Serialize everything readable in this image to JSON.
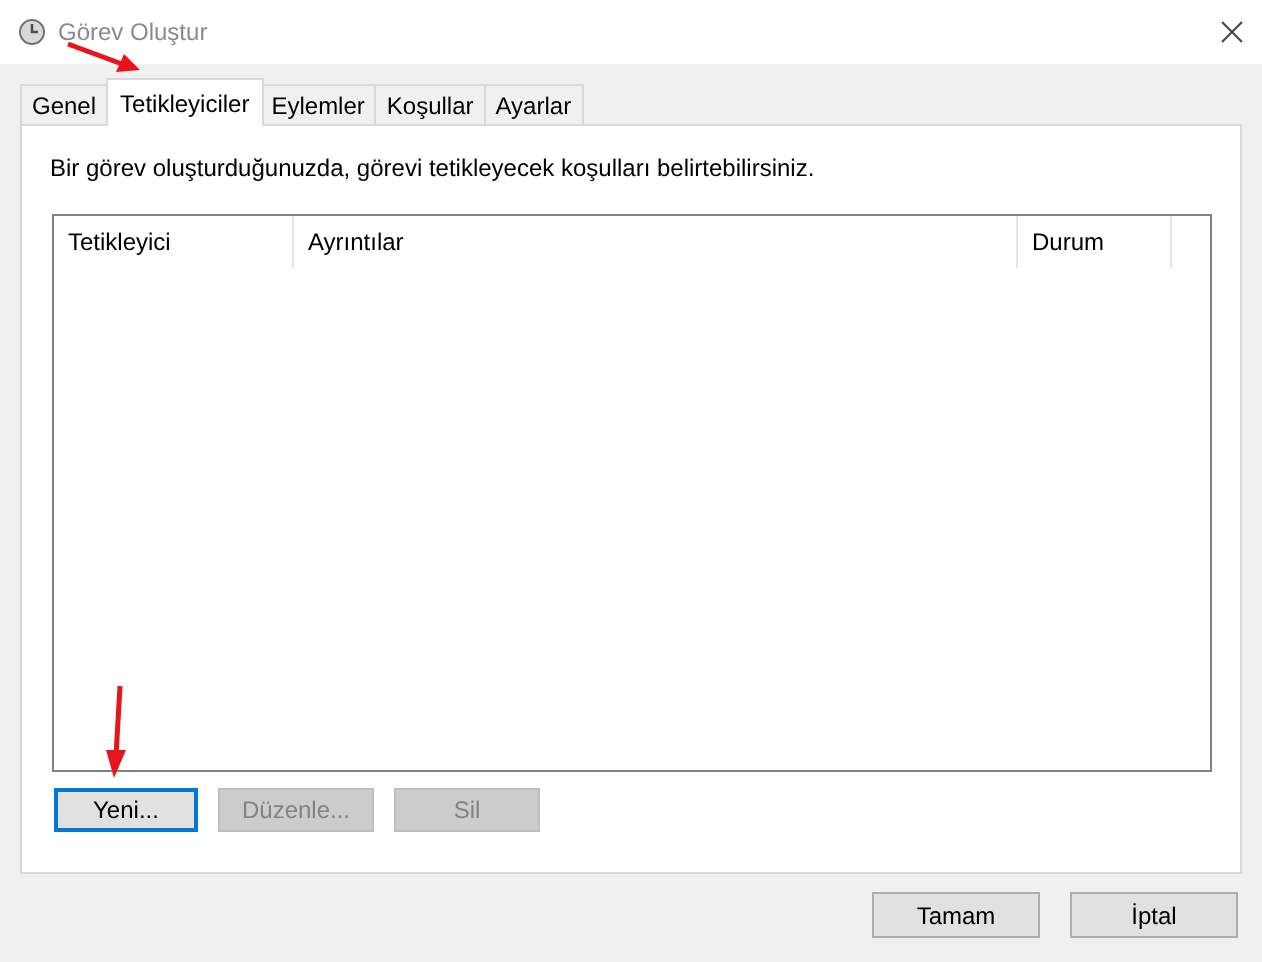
{
  "window": {
    "title": "Görev Oluştur"
  },
  "tabs": [
    {
      "label": "Genel",
      "selected": false
    },
    {
      "label": "Tetikleyiciler",
      "selected": true
    },
    {
      "label": "Eylemler",
      "selected": false
    },
    {
      "label": "Koşullar",
      "selected": false
    },
    {
      "label": "Ayarlar",
      "selected": false
    }
  ],
  "description": "Bir görev oluşturduğunuzda, görevi tetikleyecek koşulları belirtebilirsiniz.",
  "table": {
    "columns": [
      "Tetikleyici",
      "Ayrıntılar",
      "Durum"
    ]
  },
  "list_buttons": [
    {
      "label": "Yeni...",
      "disabled": false,
      "focused": true
    },
    {
      "label": "Düzenle...",
      "disabled": true,
      "focused": false
    },
    {
      "label": "Sil",
      "disabled": true,
      "focused": false
    }
  ],
  "dialog_buttons": [
    {
      "label": "Tamam"
    },
    {
      "label": "İptal"
    }
  ]
}
